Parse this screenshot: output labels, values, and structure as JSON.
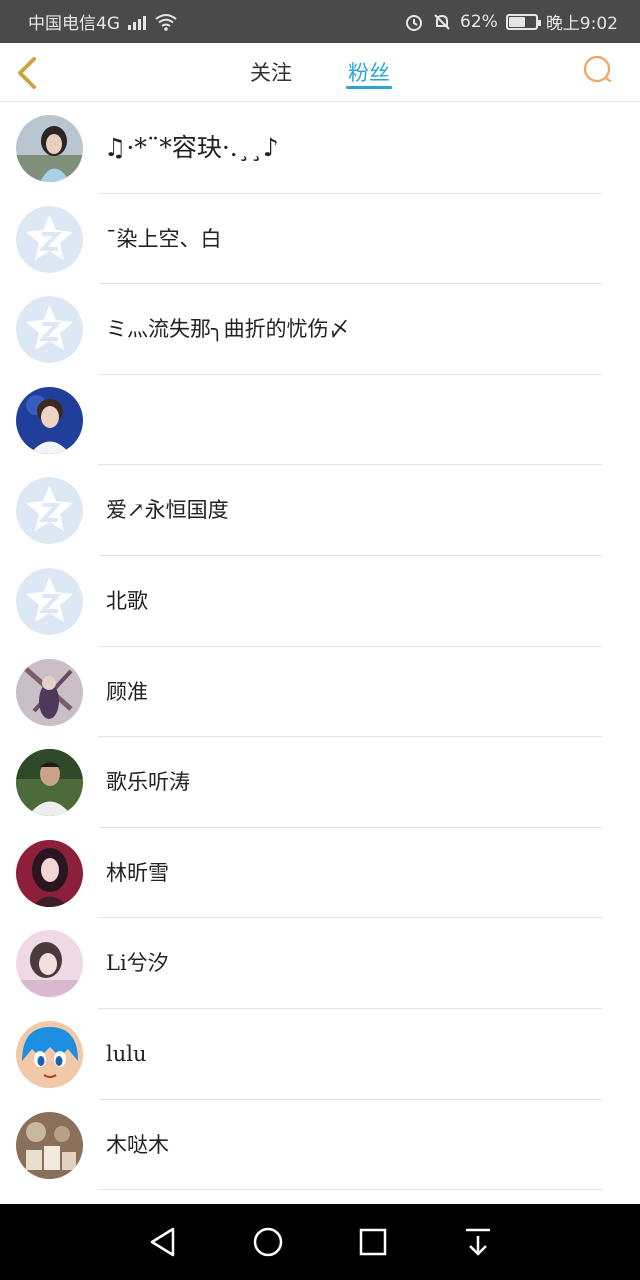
{
  "status_bar": {
    "carrier": "中国电信4G",
    "network": "4G",
    "battery_percent": "62%",
    "time": "晚上9:02",
    "battery_level": 0.62
  },
  "header": {
    "tabs": [
      {
        "label": "关注",
        "active": false
      },
      {
        "label": "粉丝",
        "active": true
      }
    ],
    "accent_color": "#2aa5d8",
    "back_icon": "chevron-left-icon",
    "search_icon": "search-icon"
  },
  "fans": [
    {
      "name": "♫·*¨*容玦·.¸¸♪",
      "avatar": "photo-girl-dark-hair"
    },
    {
      "name": "ˉ染上空、白",
      "avatar": "default-qq-avatar"
    },
    {
      "name": "ミ灬流失那╮曲折的忧伤〆",
      "avatar": "default-qq-avatar"
    },
    {
      "name": "",
      "avatar": "photo-boy-blue-background"
    },
    {
      "name": "爱↗永恒国度",
      "avatar": "default-qq-avatar"
    },
    {
      "name": "北歌",
      "avatar": "default-qq-avatar"
    },
    {
      "name": "顾准",
      "avatar": "illustration-purple"
    },
    {
      "name": "歌乐听涛",
      "avatar": "photo-man-outdoors"
    },
    {
      "name": "林昕雪",
      "avatar": "photo-woman-red"
    },
    {
      "name": "Li兮汐",
      "avatar": "photo-woman-pink"
    },
    {
      "name": "lulu",
      "avatar": "cartoon-blue-hair"
    },
    {
      "name": "木哒木",
      "avatar": "photo-gift-bags"
    }
  ],
  "nav_bar": {
    "buttons": [
      "back-triangle-icon",
      "home-circle-icon",
      "recents-square-icon",
      "notifications-down-icon"
    ]
  }
}
